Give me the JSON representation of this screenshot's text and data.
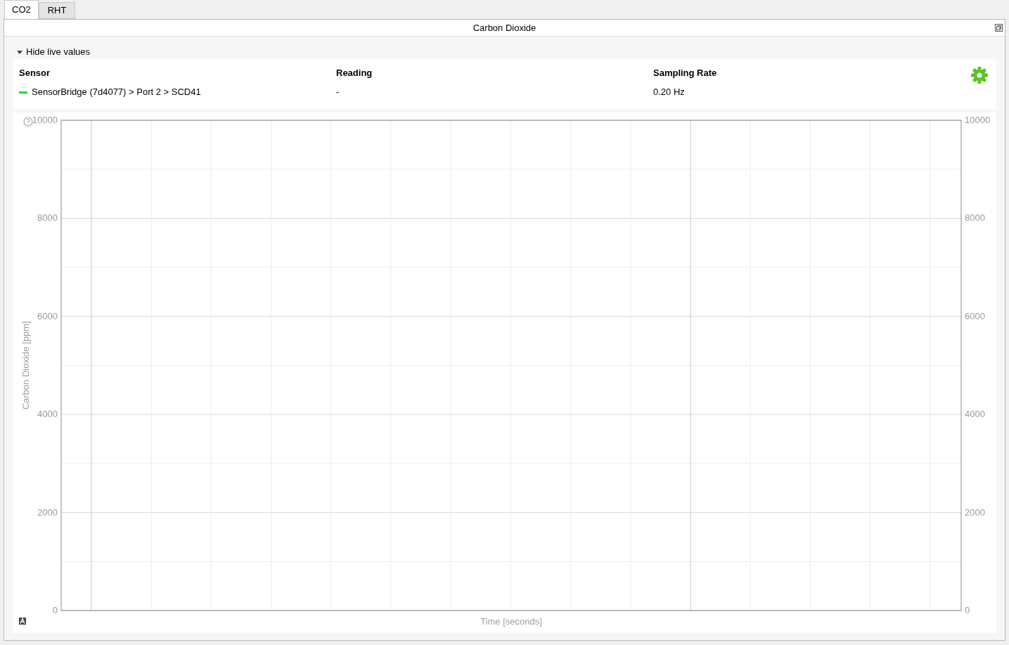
{
  "tabs": [
    {
      "label": "CO2",
      "selected": true
    },
    {
      "label": "RHT",
      "selected": false
    }
  ],
  "panel": {
    "title": "Carbon Dioxide",
    "live_values": {
      "toggle_label": "Hide live values",
      "expanded": true,
      "columns": [
        "Sensor",
        "Reading",
        "Sampling Rate"
      ],
      "rows": [
        {
          "color": "#22dd22",
          "sensor": "SensorBridge (7d4077) > Port 2 > SCD41",
          "reading": "-",
          "sampling_rate": "0.20 Hz"
        }
      ]
    },
    "chart_data": {
      "type": "line",
      "categories": [
        null,
        null,
        null,
        null,
        null,
        null,
        null,
        null,
        null,
        null,
        null,
        null,
        null,
        null,
        null
      ],
      "xlabel": "Time [seconds]",
      "ylabel": "Carbon Dioxide [ppm]",
      "ylim": [
        0,
        10000
      ],
      "yticks": [
        {
          "value": 0,
          "label": "0"
        },
        {
          "value": 2000,
          "label": "2000"
        },
        {
          "value": 4000,
          "label": "4000"
        },
        {
          "value": 6000,
          "label": "6000"
        },
        {
          "value": 8000,
          "label": "8000"
        },
        {
          "value": 10000,
          "label": "10000"
        }
      ],
      "grid": true
    },
    "right_axis_labels": [
      "10000",
      "8000",
      "6000",
      "4000",
      "2000",
      "0"
    ]
  }
}
